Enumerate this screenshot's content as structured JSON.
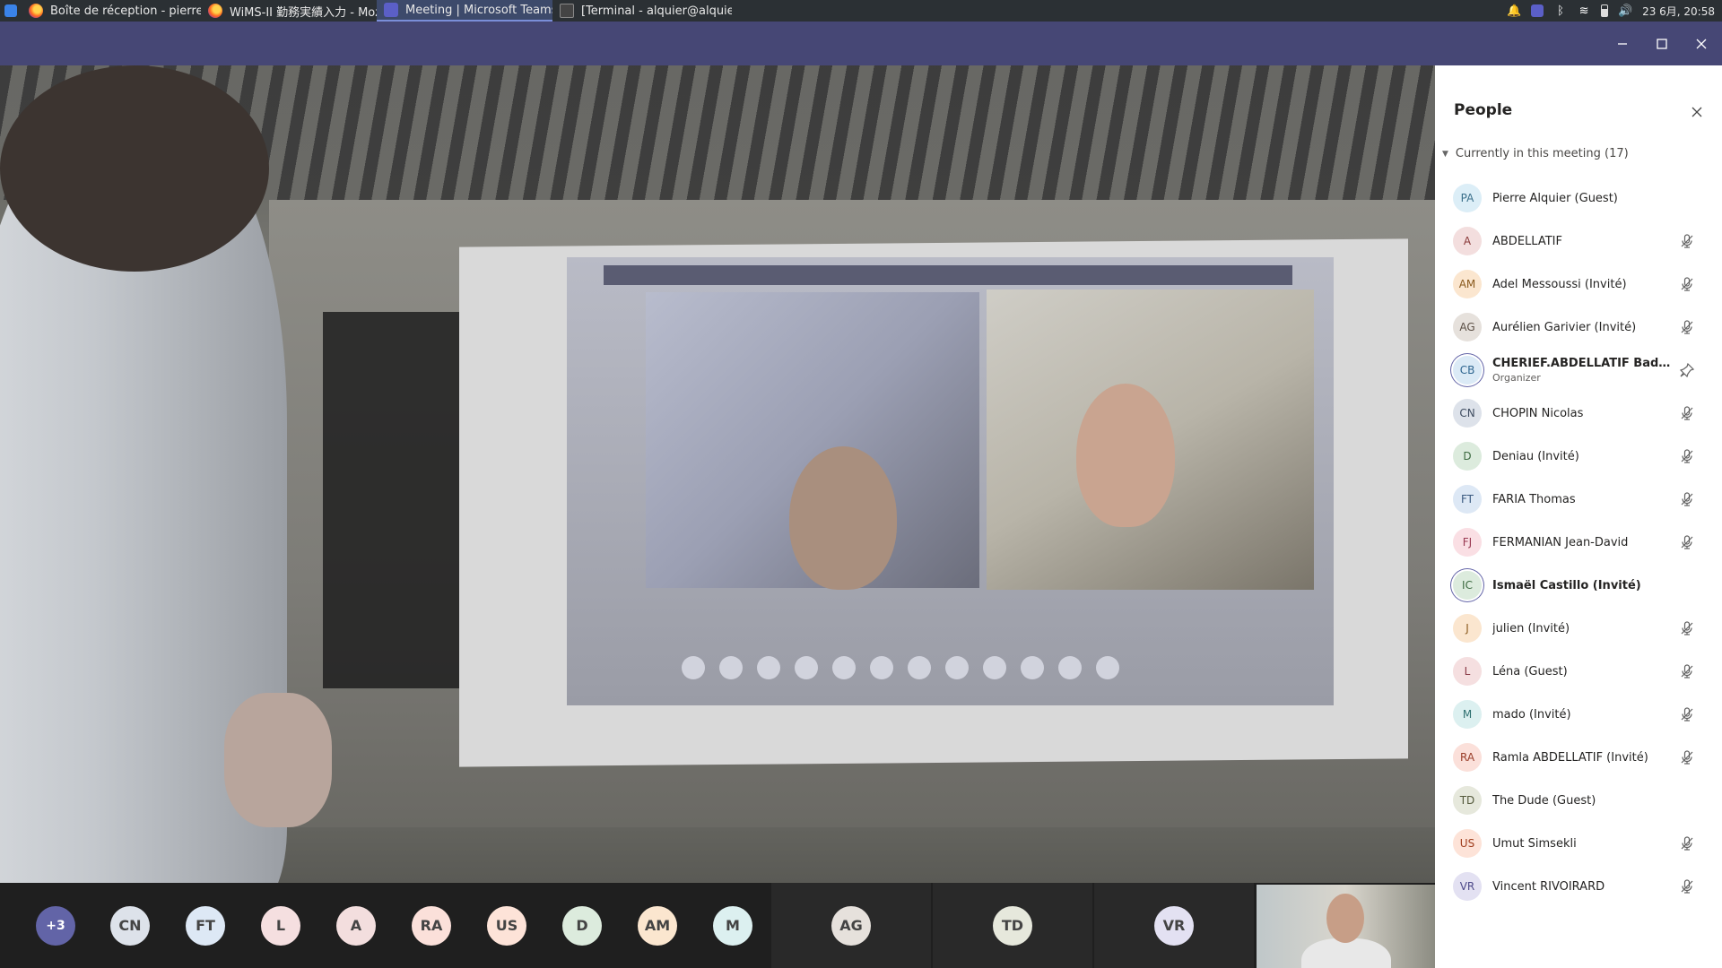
{
  "taskbar": {
    "items": [
      {
        "label": "Boîte de réception - pierre.a...",
        "icon": "firefox-icon"
      },
      {
        "label": "WiMS-II 勤務実績入力 - Mozi...",
        "icon": "firefox-icon"
      },
      {
        "label": "Meeting | Microsoft Teams",
        "icon": "teams-icon"
      },
      {
        "label": "[Terminal - alquier@alquier-...",
        "icon": "terminal-icon"
      }
    ],
    "clock": "23 6月, 20:58"
  },
  "people_panel": {
    "title": "People",
    "section_label": "Currently in this meeting (17)",
    "participants": [
      {
        "initials": "PA",
        "name": "Pierre Alquier (Guest)",
        "role": "",
        "muted": false,
        "bold": false,
        "ring": false,
        "color": "#dceef7",
        "fg": "#3a6f8a"
      },
      {
        "initials": "A",
        "name": "ABDELLATIF",
        "role": "",
        "muted": true,
        "bold": false,
        "ring": false,
        "color": "#f3dede",
        "fg": "#8a3a3a"
      },
      {
        "initials": "AM",
        "name": "Adel Messoussi (Invité)",
        "role": "",
        "muted": true,
        "bold": false,
        "ring": false,
        "color": "#fbe6cf",
        "fg": "#8a5a1e"
      },
      {
        "initials": "AG",
        "name": "Aurélien Garivier (Invité)",
        "role": "",
        "muted": true,
        "bold": false,
        "ring": false,
        "color": "#e6e1dc",
        "fg": "#5a4e44"
      },
      {
        "initials": "CB",
        "name": "CHERIEF.ABDELLATIF Badr...",
        "role": "Organizer",
        "muted": false,
        "bold": true,
        "ring": true,
        "color": "#dbeaf6",
        "fg": "#2f6690"
      },
      {
        "initials": "CN",
        "name": "CHOPIN Nicolas",
        "role": "",
        "muted": true,
        "bold": false,
        "ring": false,
        "color": "#dde2ea",
        "fg": "#3e4c60"
      },
      {
        "initials": "D",
        "name": "Deniau (Invité)",
        "role": "",
        "muted": true,
        "bold": false,
        "ring": false,
        "color": "#dcebdd",
        "fg": "#3c6a40"
      },
      {
        "initials": "FT",
        "name": "FARIA Thomas",
        "role": "",
        "muted": true,
        "bold": false,
        "ring": false,
        "color": "#dde8f5",
        "fg": "#3a5a80"
      },
      {
        "initials": "FJ",
        "name": "FERMANIAN Jean-David",
        "role": "",
        "muted": true,
        "bold": false,
        "ring": false,
        "color": "#fadfe4",
        "fg": "#9a3a52"
      },
      {
        "initials": "IC",
        "name": "Ismaël Castillo (Invité)",
        "role": "",
        "muted": false,
        "bold": true,
        "ring": true,
        "color": "#dcebdd",
        "fg": "#3c6a40"
      },
      {
        "initials": "J",
        "name": "julien (Invité)",
        "role": "",
        "muted": true,
        "bold": false,
        "ring": false,
        "color": "#fbe6cf",
        "fg": "#8a5a1e"
      },
      {
        "initials": "L",
        "name": "Léna (Guest)",
        "role": "",
        "muted": true,
        "bold": false,
        "ring": false,
        "color": "#f5dfe0",
        "fg": "#8a3a46"
      },
      {
        "initials": "M",
        "name": "mado (Invité)",
        "role": "",
        "muted": true,
        "bold": false,
        "ring": false,
        "color": "#dcf0f0",
        "fg": "#2f7070"
      },
      {
        "initials": "RA",
        "name": "Ramla ABDELLATIF (Invité)",
        "role": "",
        "muted": true,
        "bold": false,
        "ring": false,
        "color": "#fbe0da",
        "fg": "#9a3e2a"
      },
      {
        "initials": "TD",
        "name": "The Dude (Guest)",
        "role": "",
        "muted": false,
        "bold": false,
        "ring": false,
        "color": "#e6e8dc",
        "fg": "#555a3c"
      },
      {
        "initials": "US",
        "name": "Umut Simsekli",
        "role": "",
        "muted": true,
        "bold": false,
        "ring": false,
        "color": "#fde3d8",
        "fg": "#a03e1e"
      },
      {
        "initials": "VR",
        "name": "Vincent RIVOIRARD",
        "role": "",
        "muted": true,
        "bold": false,
        "ring": false,
        "color": "#e3e1f2",
        "fg": "#4e4a8a"
      }
    ]
  },
  "strip": {
    "overflow_label": "+3",
    "avatars": [
      {
        "initials": "CN",
        "color": "#dde2ea"
      },
      {
        "initials": "FT",
        "color": "#dde8f5"
      },
      {
        "initials": "L",
        "color": "#f5dfe0"
      },
      {
        "initials": "A",
        "color": "#f3dede"
      },
      {
        "initials": "RA",
        "color": "#fbe0da"
      },
      {
        "initials": "US",
        "color": "#fde3d8"
      },
      {
        "initials": "D",
        "color": "#dcebdd"
      },
      {
        "initials": "AM",
        "color": "#fbe6cf"
      },
      {
        "initials": "M",
        "color": "#dcf0f0"
      }
    ],
    "tiles": [
      {
        "initials": "AG",
        "color": "#e6e1dc"
      },
      {
        "initials": "TD",
        "color": "#e6e8dc"
      },
      {
        "initials": "VR",
        "color": "#e3e1f2"
      }
    ]
  },
  "colors": {
    "teams_titlebar": "#464775",
    "teams_accent": "#6264a7"
  }
}
